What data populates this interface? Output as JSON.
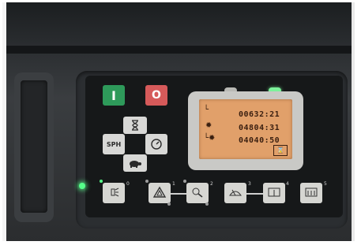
{
  "controls": {
    "start_label": "I",
    "stop_label": "O"
  },
  "dpad": {
    "up_icon": "hourglass-icon",
    "left_label": "SPH",
    "right_icon": "speedometer-icon",
    "down_icon": "tortoise-icon"
  },
  "display": {
    "line1": "00632:21",
    "line2": "04804:31",
    "line3": "04040:50",
    "status_left": "gray",
    "status_right": "green"
  },
  "function_keys": [
    {
      "number": "0",
      "icon": "work-light-icon"
    },
    {
      "number": "1",
      "icon": "hazard-icon"
    },
    {
      "number": "2",
      "icon": "beacon-icon"
    },
    {
      "number": "3",
      "icon": "wiper-front-icon"
    },
    {
      "number": "4",
      "icon": "wiper-rear-icon"
    },
    {
      "number": "5",
      "icon": "rear-defrost-icon"
    }
  ],
  "colors": {
    "start": "#2e9a5a",
    "stop": "#d65a5a",
    "lcd": "#e1a06a",
    "led_active": "#56ff8a"
  }
}
